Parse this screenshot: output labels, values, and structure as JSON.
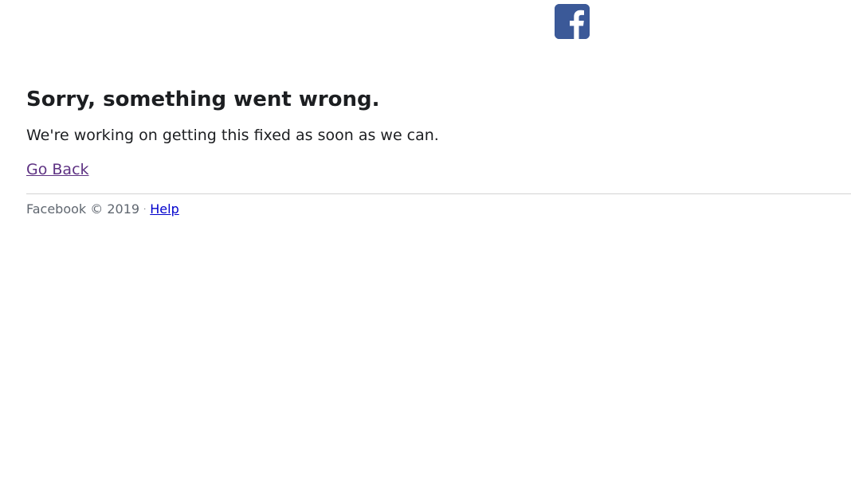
{
  "brand": {
    "logo_icon": "facebook-logo-icon",
    "logo_color": "#3b5998"
  },
  "error": {
    "title": "Sorry, something went wrong.",
    "message": "We're working on getting this fixed as soon as we can.",
    "go_back_label": "Go Back"
  },
  "footer": {
    "copyright": "Facebook © 2019",
    "separator": "·",
    "help_label": "Help"
  },
  "colors": {
    "text": "#1c1e21",
    "muted": "#606770",
    "visited_link": "#5e3283",
    "link": "#0000cc",
    "divider": "#d3d3d3"
  }
}
